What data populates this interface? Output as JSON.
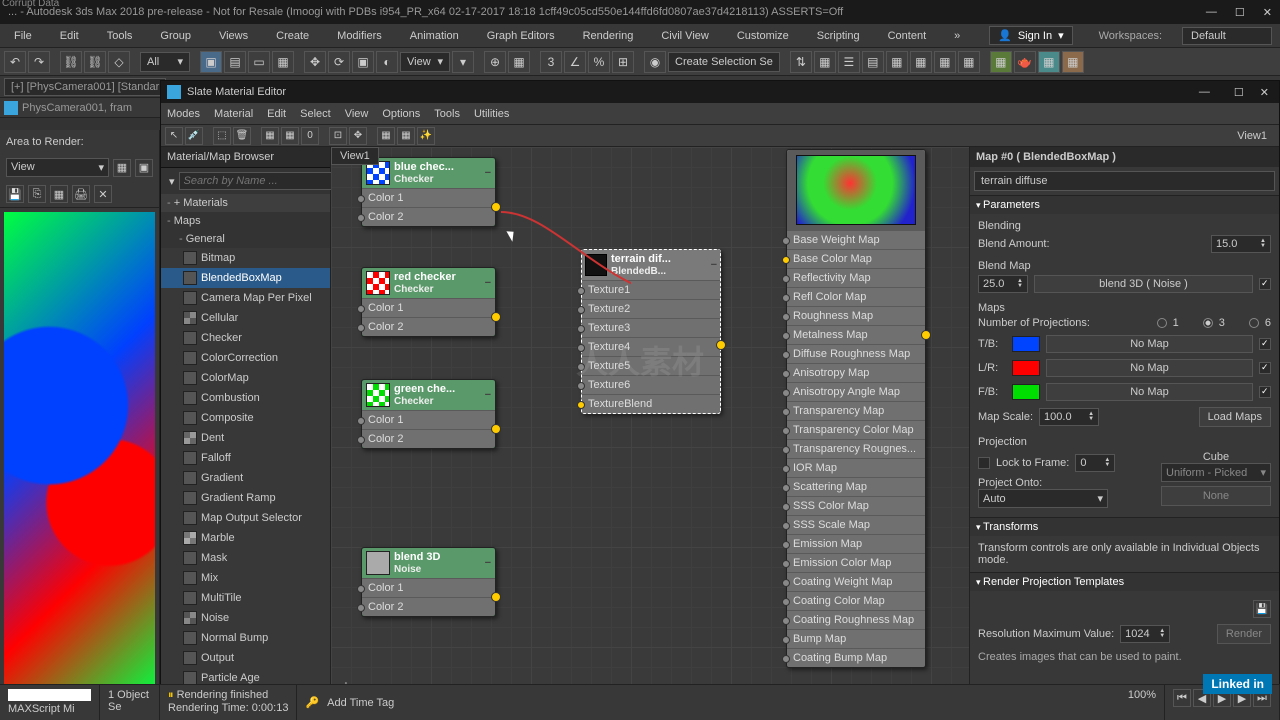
{
  "corrupt": "Corrupt Data",
  "title": "... - Autodesk 3ds Max 2018 pre-release - Not for Resale (Imoogi with PDBs i954_PR_x64 02-17-2017 18:18 1cff49c05cd550e144ffd6fd0807ae37d4218113) ASSERTS=Off",
  "menus": [
    "File",
    "Edit",
    "Tools",
    "Group",
    "Views",
    "Create",
    "Modifiers",
    "Animation",
    "Graph Editors",
    "Rendering",
    "Civil View",
    "Customize",
    "Scripting",
    "Content"
  ],
  "signin": "Sign In",
  "wslabel": "Workspaces:",
  "wsval": "Default",
  "toolbar": {
    "all": "All",
    "view": "View",
    "selset": "Create Selection Se"
  },
  "ribbon": {
    "tab": "[+] [PhysCamera001] [Standar",
    "cam": "PhysCamera001, fram"
  },
  "render": {
    "area": "Area to Render:",
    "viewopt": "View"
  },
  "slate": {
    "title": "Slate Material Editor",
    "menus": [
      "Modes",
      "Material",
      "Edit",
      "Select",
      "View",
      "Options",
      "Tools",
      "Utilities"
    ],
    "view1": "View1",
    "view1tab": "View1"
  },
  "browser": {
    "title": "Material/Map Browser",
    "search": "Search by Name ...",
    "cats": {
      "mat": "+ Materials",
      "maps": "Maps",
      "general": "General"
    },
    "items": [
      "Bitmap",
      "BlendedBoxMap",
      "Camera Map Per Pixel",
      "Cellular",
      "Checker",
      "ColorCorrection",
      "ColorMap",
      "Combustion",
      "Composite",
      "Dent",
      "Falloff",
      "Gradient",
      "Gradient Ramp",
      "Map Output Selector",
      "Marble",
      "Mask",
      "Mix",
      "MultiTile",
      "Noise",
      "Normal Bump",
      "Output",
      "Particle Age"
    ]
  },
  "nodes": {
    "blue": {
      "title": "blue chec...",
      "sub": "Checker",
      "s1": "Color 1",
      "s2": "Color 2"
    },
    "red": {
      "title": "red checker",
      "sub": "Checker",
      "s1": "Color 1",
      "s2": "Color 2"
    },
    "green": {
      "title": "green che...",
      "sub": "Checker",
      "s1": "Color 1",
      "s2": "Color 2"
    },
    "noise": {
      "title": "blend 3D",
      "sub": "Noise",
      "s1": "Color 1",
      "s2": "Color 2"
    },
    "terrain": {
      "title": "terrain dif...",
      "sub": "BlendedB...",
      "tex": [
        "Texture1",
        "Texture2",
        "Texture3",
        "Texture4",
        "Texture5",
        "Texture6",
        "TextureBlend"
      ]
    },
    "mat": {
      "slots": [
        "Base Weight Map",
        "Base Color Map",
        "Reflectivity Map",
        "Refl Color Map",
        "Roughness Map",
        "Metalness Map",
        "Diffuse Roughness Map",
        "Anisotropy Map",
        "Anisotropy Angle Map",
        "Transparency Map",
        "Transparency Color Map",
        "Transparency Rougnes...",
        "IOR Map",
        "Scattering Map",
        "SSS Color Map",
        "SSS Scale Map",
        "Emission Map",
        "Emission Color Map",
        "Coating Weight Map",
        "Coating Color Map",
        "Coating Roughness Map",
        "Bump Map",
        "Coating Bump Map"
      ]
    }
  },
  "params": {
    "head": "Map #0  ( BlendedBoxMap )",
    "name": "terrain diffuse",
    "rollParams": "Parameters",
    "blending": "Blending",
    "blendAmount": {
      "label": "Blend Amount:",
      "val": "15.0"
    },
    "blendMap": "Blend Map",
    "blendMapVal": "25.0",
    "blendMapBtn": "blend 3D  ( Noise )",
    "maps": "Maps",
    "numProj": {
      "label": "Number of Projections:",
      "opts": [
        "1",
        "3",
        "6"
      ],
      "sel": "3"
    },
    "projrows": [
      {
        "label": "T/B:",
        "color": "#0044ff",
        "btn": "No Map"
      },
      {
        "label": "L/R:",
        "color": "#ff0000",
        "btn": "No Map"
      },
      {
        "label": "F/B:",
        "color": "#00dd00",
        "btn": "No Map"
      }
    ],
    "mapScale": {
      "label": "Map Scale:",
      "val": "100.0",
      "btn": "Load Maps"
    },
    "projection": "Projection",
    "lockFrame": {
      "label": "Lock to Frame:",
      "val": "0"
    },
    "cube": "Cube",
    "uniform": "Uniform - Picked",
    "none": "None",
    "projectOnto": "Project Onto:",
    "auto": "Auto",
    "transforms": "Transforms",
    "transText": "Transform controls are only available in Individual Objects mode.",
    "rpt": "Render Projection Templates",
    "resMax": {
      "label": "Resolution Maximum Value:",
      "val": "1024",
      "btn": "Render"
    },
    "hint": "Creates images that can be used to paint."
  },
  "footer": {
    "objsel": "1 Object Se",
    "maxscript": "MAXScript Mi",
    "rendfin": "Rendering finished",
    "rendtime": "Rendering Time: 0:00:13",
    "addtag": "Add Time Tag",
    "zoom": "100%"
  },
  "watermark": "人人素材",
  "linkedin": "Linked in"
}
